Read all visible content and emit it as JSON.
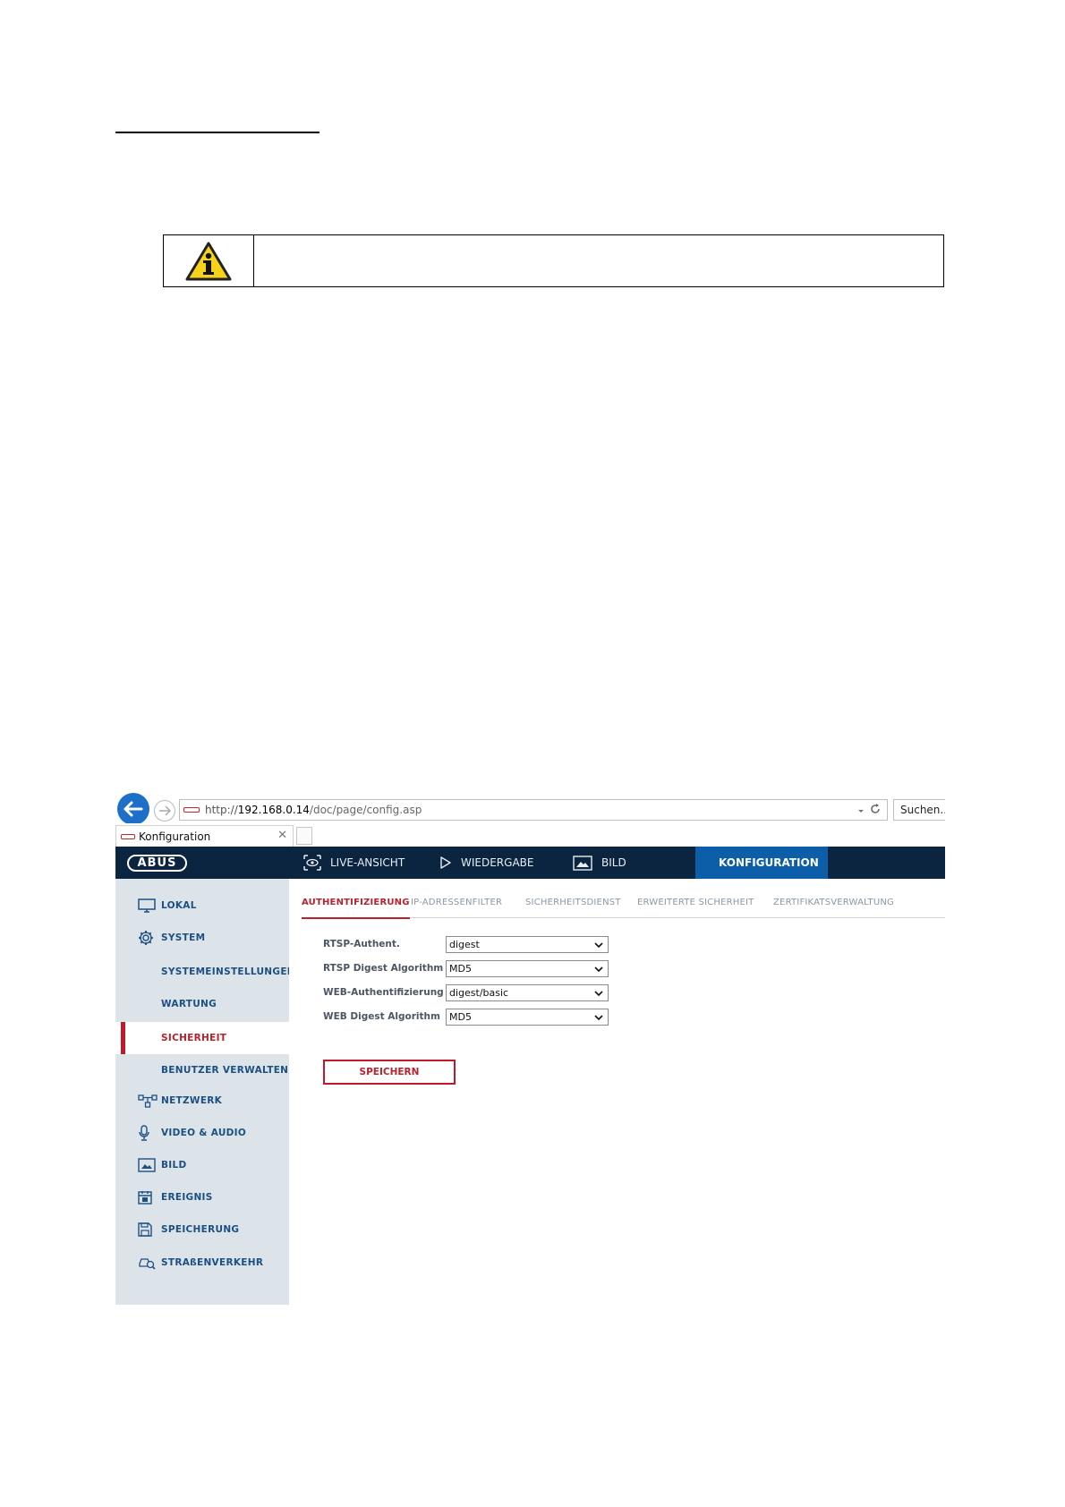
{
  "browser": {
    "url_prefix": "http://",
    "url_host": "192.168.0.14",
    "url_path": "/doc/page/config.asp",
    "search_placeholder": "Suchen...",
    "tab_title": "Konfiguration"
  },
  "brand": {
    "logo_text": "ABUS"
  },
  "topnav": {
    "items": [
      {
        "label": "LIVE-ANSICHT",
        "icon": "eye-icon"
      },
      {
        "label": "WIEDERGABE",
        "icon": "play-icon"
      },
      {
        "label": "BILD",
        "icon": "image-icon"
      },
      {
        "label": "KONFIGURATION",
        "icon": "tools-icon",
        "active": true
      }
    ]
  },
  "sidebar": {
    "items": [
      {
        "label": "LOKAL",
        "icon": "monitor-icon"
      },
      {
        "label": "SYSTEM",
        "icon": "gear-icon"
      },
      {
        "label": "SYSTEMEINSTELLUNGEN",
        "sub": true
      },
      {
        "label": "WARTUNG",
        "sub": true
      },
      {
        "label": "SICHERHEIT",
        "sub": true,
        "active": true
      },
      {
        "label": "BENUTZER VERWALTEN",
        "sub": true
      },
      {
        "label": "NETZWERK",
        "icon": "network-icon"
      },
      {
        "label": "VIDEO & AUDIO",
        "icon": "microphone-icon"
      },
      {
        "label": "BILD",
        "icon": "image-icon"
      },
      {
        "label": "EREIGNIS",
        "icon": "calendar-icon"
      },
      {
        "label": "SPEICHERUNG",
        "icon": "floppy-disk-icon"
      },
      {
        "label": "STRAßENVERKEHR",
        "icon": "car-search-icon"
      }
    ]
  },
  "subtabs": [
    {
      "label": "AUTHENTIFIZIERUNG",
      "active": true
    },
    {
      "label": "IP-ADRESSENFILTER"
    },
    {
      "label": "SICHERHEITSDIENST"
    },
    {
      "label": "ERWEITERTE SICHERHEIT"
    },
    {
      "label": "ZERTIFIKATSVERWALTUNG"
    }
  ],
  "form": {
    "rows": [
      {
        "label": "RTSP-Authent.",
        "value": "digest"
      },
      {
        "label": "RTSP Digest Algorithm",
        "value": "MD5"
      },
      {
        "label": "WEB-Authentifizierung",
        "value": "digest/basic"
      },
      {
        "label": "WEB Digest Algorithm",
        "value": "MD5"
      }
    ],
    "save_label": "SPEICHERN"
  },
  "colors": {
    "nav_bg": "#0b2440",
    "nav_active": "#0d5ea8",
    "accent_red": "#c0192a",
    "sidebar_bg": "#dce4ea",
    "sidebar_text": "#1c4f82"
  }
}
